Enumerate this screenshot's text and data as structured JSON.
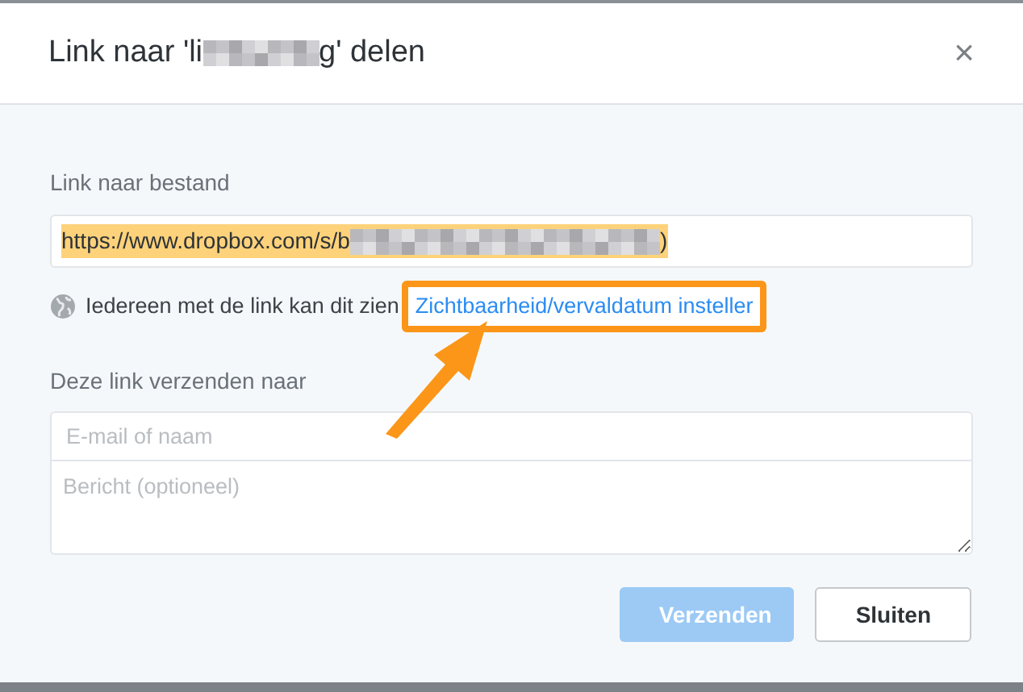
{
  "dialog": {
    "title_start": "Link naar 'li",
    "title_end": "g' delen",
    "close": "×"
  },
  "link_section": {
    "label": "Link naar bestand",
    "value_start": "https://www.dropbox.com/s/b",
    "value_end": ")",
    "text_selected": true
  },
  "visibility": {
    "text": "Iedereen met de link kan dit zien",
    "link": "Zichtbaarheid/vervaldatum insteller",
    "highlighted": true
  },
  "send_section": {
    "label": "Deze link verzenden naar",
    "email_placeholder": "E-mail of naam",
    "message_placeholder": "Bericht (optioneel)"
  },
  "buttons": [
    {
      "label": "Verzenden",
      "kind": "primary",
      "disabled": true
    },
    {
      "label": "Sluiten",
      "kind": "secondary",
      "disabled": false
    }
  ]
}
